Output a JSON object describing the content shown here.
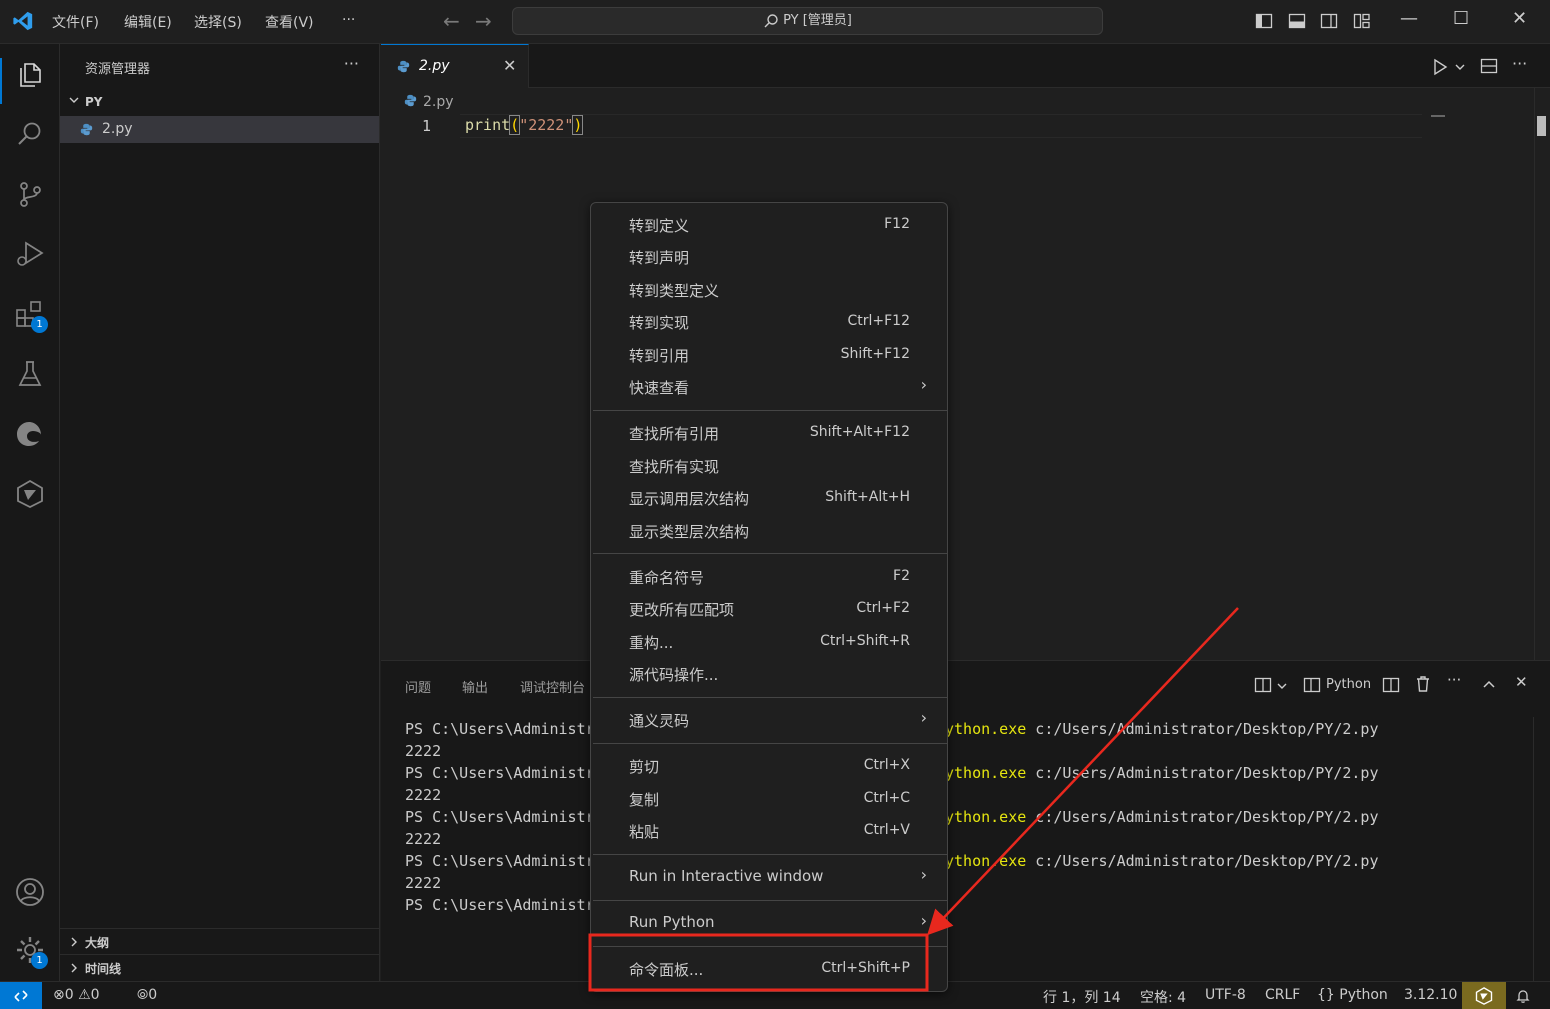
{
  "titlebar": {
    "menus": [
      "文件(F)",
      "编辑(E)",
      "选择(S)",
      "查看(V)",
      "···"
    ],
    "command_center": "PY [管理员]"
  },
  "activitybar": {
    "extensions_badge": "1",
    "settings_badge": "1"
  },
  "sidebar": {
    "title": "资源管理器",
    "more": "···",
    "folder": "PY",
    "file": "2.py",
    "outline": "大纲",
    "timeline": "时间线"
  },
  "editor": {
    "tab_label": "2.py",
    "breadcrumb": "2.py",
    "line_number": "1",
    "code": {
      "fn": "print",
      "open": "(",
      "str": "\"2222\"",
      "close": ")"
    }
  },
  "panel": {
    "tabs": [
      "问题",
      "输出",
      "调试控制台"
    ],
    "profile": "Python",
    "terminal_lines": [
      "PS C:\\Users\\Administr",
      "2222",
      "PS C:\\Users\\Administr",
      "2222",
      "PS C:\\Users\\Administr",
      "2222",
      "PS C:\\Users\\Administr",
      "2222",
      "PS C:\\Users\\Administr"
    ],
    "terminal_exe": "ython.exe",
    "terminal_path": " c:/Users/Administrator/Desktop/PY/2.py"
  },
  "context_menu": {
    "groups": [
      [
        {
          "label": "转到定义",
          "key": "F12"
        },
        {
          "label": "转到声明",
          "key": ""
        },
        {
          "label": "转到类型定义",
          "key": ""
        },
        {
          "label": "转到实现",
          "key": "Ctrl+F12"
        },
        {
          "label": "转到引用",
          "key": "Shift+F12"
        },
        {
          "label": "快速查看",
          "key": "",
          "submenu": true
        }
      ],
      [
        {
          "label": "查找所有引用",
          "key": "Shift+Alt+F12"
        },
        {
          "label": "查找所有实现",
          "key": ""
        },
        {
          "label": "显示调用层次结构",
          "key": "Shift+Alt+H"
        },
        {
          "label": "显示类型层次结构",
          "key": ""
        }
      ],
      [
        {
          "label": "重命名符号",
          "key": "F2"
        },
        {
          "label": "更改所有匹配项",
          "key": "Ctrl+F2"
        },
        {
          "label": "重构...",
          "key": "Ctrl+Shift+R"
        },
        {
          "label": "源代码操作...",
          "key": ""
        }
      ],
      [
        {
          "label": "通义灵码",
          "key": "",
          "submenu": true
        }
      ],
      [
        {
          "label": "剪切",
          "key": "Ctrl+X"
        },
        {
          "label": "复制",
          "key": "Ctrl+C"
        },
        {
          "label": "粘贴",
          "key": "Ctrl+V"
        }
      ],
      [
        {
          "label": "Run in Interactive window",
          "key": "",
          "submenu": true
        }
      ],
      [
        {
          "label": "Run Python",
          "key": "",
          "submenu": true
        }
      ],
      [
        {
          "label": "命令面板...",
          "key": "Ctrl+Shift+P"
        }
      ]
    ]
  },
  "statusbar": {
    "errors": "0",
    "warnings": "0",
    "ports": "0",
    "position": "行 1，列 14",
    "indent": "空格: 4",
    "encoding": "UTF-8",
    "eol": "CRLF",
    "language": "Python",
    "interpreter": "3.12.10"
  },
  "colors": {
    "accent": "#0078d4",
    "annotation": "#e8281e"
  }
}
